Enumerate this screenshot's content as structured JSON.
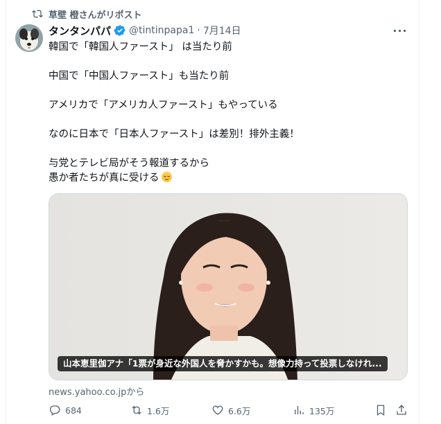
{
  "repost": {
    "label": "草壁 橙さんがリポスト",
    "icon": "repost-icon"
  },
  "author": {
    "display_name": "タンタンパパ",
    "handle": "@tintinpapa1",
    "separator": "·",
    "date": "7月14日",
    "verified": true,
    "verified_color": "#1d9bf0"
  },
  "tweet": {
    "lines": [
      "韓国で「韓国人ファースト」 は当たり前",
      "中国で「中国人ファースト」も当たり前",
      "アメリカで「アメリカ人ファースト」もやっている",
      "なのに日本で「日本人ファースト」は差別！排外主義！",
      "与党とテレビ局がそう報道するから",
      "愚か者たちが真に受ける"
    ],
    "emoji": "relieved-face-emoji"
  },
  "card": {
    "caption": "山本恵里伽アナ「1票が身近な外国人を脅かすかも。想像力持って投票しなけれ...",
    "source": "news.yahoo.co.jpから"
  },
  "actions": {
    "reply_count": "684",
    "repost_count": "1.6万",
    "like_count": "6.6万",
    "views_count": "135万"
  },
  "colors": {
    "text": "#0f1419",
    "secondary": "#536471",
    "accent": "#1d9bf0"
  }
}
